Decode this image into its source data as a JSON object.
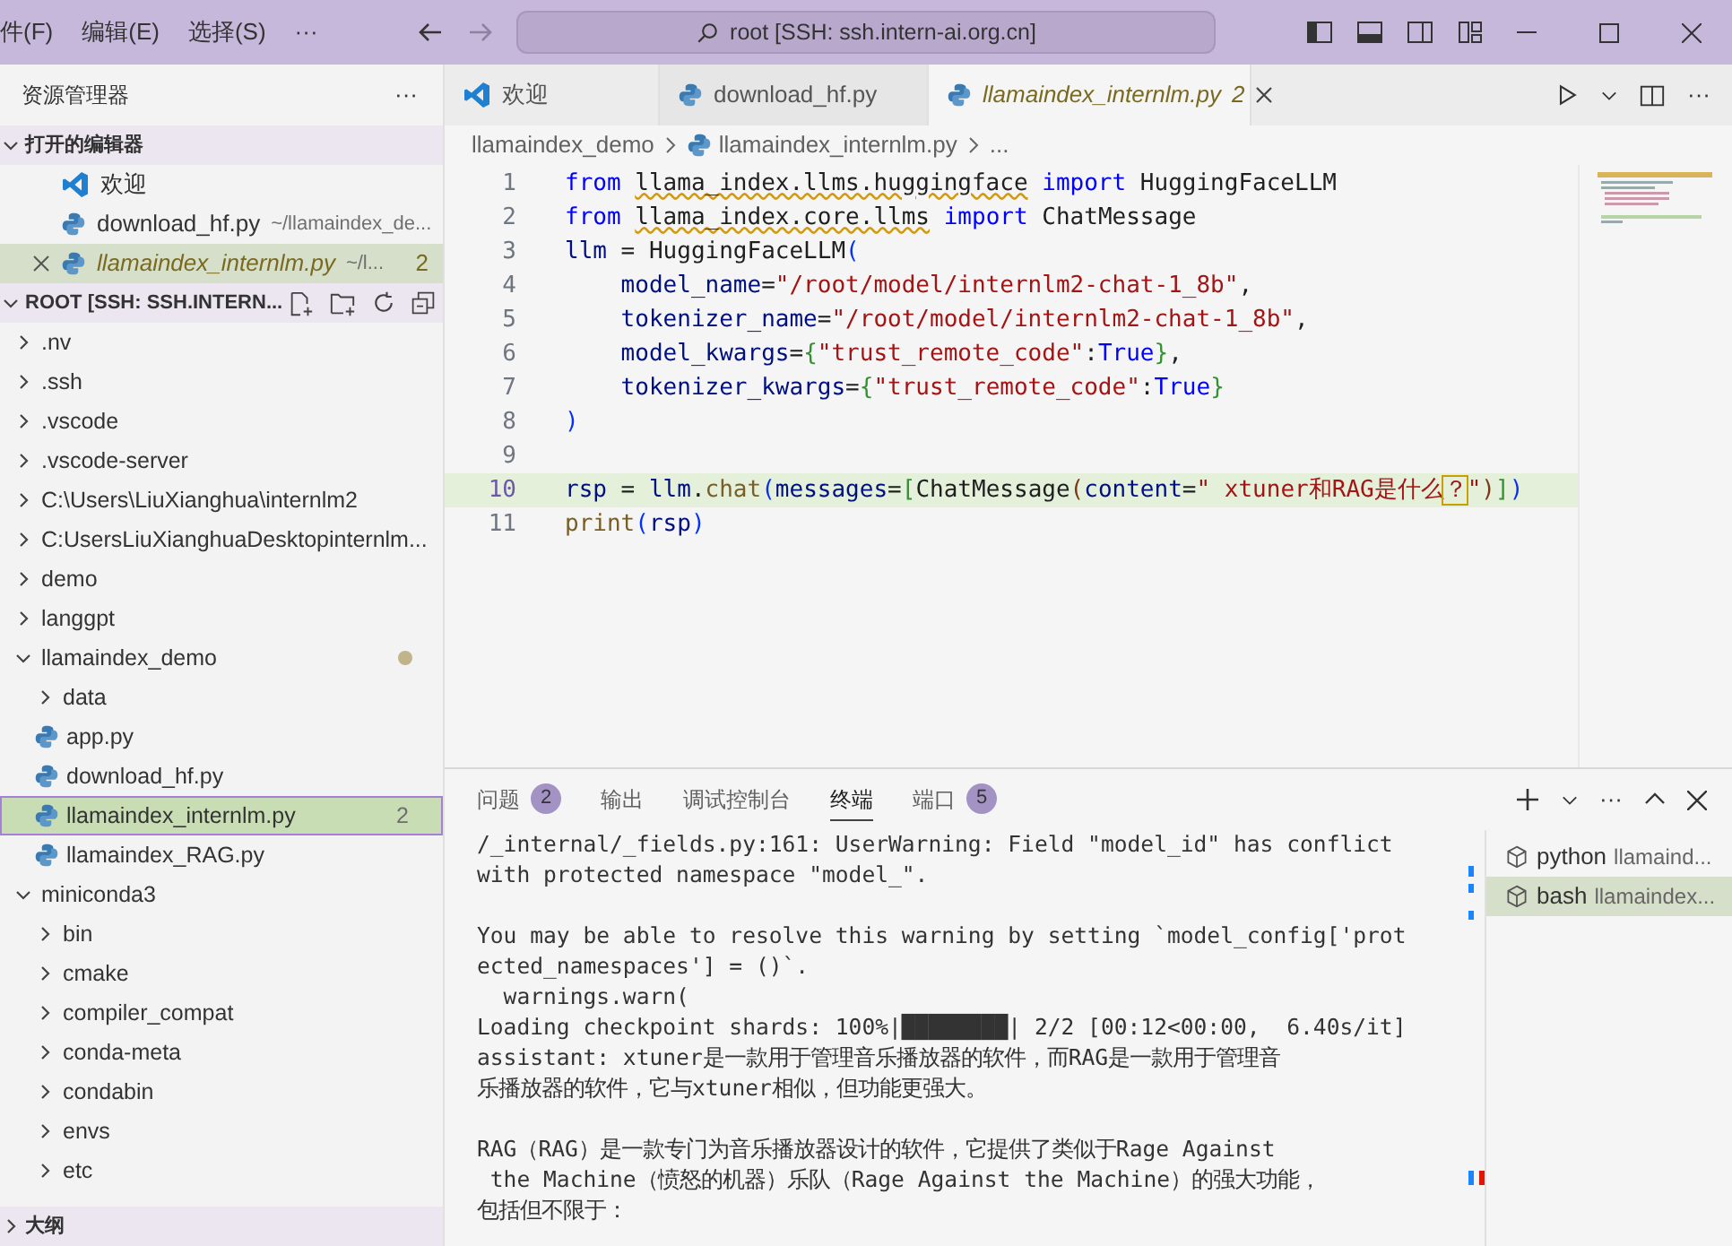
{
  "menu": [
    "件(F)",
    "编辑(E)",
    "选择(S)",
    "···"
  ],
  "command_center": "root [SSH: ssh.intern-ai.org.cn]",
  "sidebar": {
    "title": "资源管理器",
    "more": "···",
    "open_editors": {
      "title": "打开的编辑器",
      "expanded": true,
      "items": [
        {
          "kind": "welcome",
          "label": "欢迎",
          "selected": false,
          "preview": false
        },
        {
          "kind": "python",
          "label": "download_hf.py",
          "path": "~/llamaindex_de...",
          "selected": false,
          "preview": false
        },
        {
          "kind": "python",
          "label": "llamaindex_internlm.py",
          "path": "~/l...",
          "badge": "2",
          "selected": true,
          "preview": true
        }
      ]
    },
    "root": {
      "title": "ROOT [SSH: SSH.INTERN...",
      "expanded": true,
      "items": [
        {
          "kind": "folder",
          "label": ".nv",
          "expanded": false,
          "selected": false
        },
        {
          "kind": "folder",
          "label": ".ssh",
          "expanded": false,
          "selected": false
        },
        {
          "kind": "folder",
          "label": ".vscode",
          "expanded": false,
          "selected": false
        },
        {
          "kind": "folder",
          "label": ".vscode-server",
          "expanded": false,
          "selected": false
        },
        {
          "kind": "folder",
          "label": "C:\\Users\\LiuXianghua\\internlm2",
          "expanded": false,
          "selected": false
        },
        {
          "kind": "folder",
          "label": "C:UsersLiuXianghuaDesktopinternlm...",
          "expanded": false,
          "selected": false
        },
        {
          "kind": "folder",
          "label": "demo",
          "expanded": false,
          "selected": false
        },
        {
          "kind": "folder",
          "label": "langgpt",
          "expanded": false,
          "selected": false
        },
        {
          "kind": "folder",
          "label": "llamaindex_demo",
          "expanded": true,
          "selected": false,
          "modified": true,
          "children": [
            {
              "kind": "folder",
              "label": "data",
              "expanded": false,
              "selected": false
            },
            {
              "kind": "python",
              "label": "app.py",
              "selected": false
            },
            {
              "kind": "python",
              "label": "download_hf.py",
              "selected": false
            },
            {
              "kind": "python",
              "label": "llamaindex_internlm.py",
              "selected": true,
              "badge": "2"
            },
            {
              "kind": "python",
              "label": "llamaindex_RAG.py",
              "selected": false
            }
          ]
        },
        {
          "kind": "folder",
          "label": "miniconda3",
          "expanded": true,
          "selected": false,
          "children": [
            {
              "kind": "folder",
              "label": "bin",
              "expanded": false,
              "selected": false
            },
            {
              "kind": "folder",
              "label": "cmake",
              "expanded": false,
              "selected": false
            },
            {
              "kind": "folder",
              "label": "compiler_compat",
              "expanded": false,
              "selected": false
            },
            {
              "kind": "folder",
              "label": "conda-meta",
              "expanded": false,
              "selected": false
            },
            {
              "kind": "folder",
              "label": "condabin",
              "expanded": false,
              "selected": false
            },
            {
              "kind": "folder",
              "label": "envs",
              "expanded": false,
              "selected": false
            },
            {
              "kind": "folder",
              "label": "etc",
              "expanded": false,
              "selected": false
            }
          ]
        }
      ]
    },
    "sections": [
      {
        "title": "大纲",
        "expanded": false
      }
    ]
  },
  "editor": {
    "tabs": [
      {
        "kind": "welcome",
        "label": "欢迎",
        "selected": false,
        "preview": false
      },
      {
        "kind": "python",
        "label": "download_hf.py",
        "selected": false,
        "preview": false
      },
      {
        "kind": "python",
        "label": "llamaindex_internlm.py",
        "badge": "2",
        "selected": true,
        "preview": true
      }
    ],
    "breadcrumbs": [
      "llamaindex_demo",
      "llamaindex_internlm.py",
      "..."
    ],
    "lines": [
      {
        "number": "1",
        "current": false,
        "tokens": [
          {
            "text": "from ",
            "kind": "keyword"
          },
          {
            "text": "llama_index.llms.huggingface",
            "kind": "warning"
          },
          {
            "text": " import",
            "kind": "keyword"
          },
          {
            "text": " HuggingFaceLLM",
            "kind": "plain"
          }
        ]
      },
      {
        "number": "2",
        "current": false,
        "tokens": [
          {
            "text": "from ",
            "kind": "keyword"
          },
          {
            "text": "llama_index.core.llms",
            "kind": "warning"
          },
          {
            "text": " import",
            "kind": "keyword"
          },
          {
            "text": " ChatMessage",
            "kind": "plain"
          }
        ]
      },
      {
        "number": "3",
        "current": false,
        "tokens": [
          {
            "text": "llm",
            "kind": "variable"
          },
          {
            "text": " = HuggingFaceLLM",
            "kind": "plain"
          },
          {
            "text": "(",
            "kind": "bracket1"
          }
        ]
      },
      {
        "number": "4",
        "current": false,
        "tokens": [
          {
            "text": "    model_name",
            "kind": "variable"
          },
          {
            "text": "=",
            "kind": "plain"
          },
          {
            "text": "\"/root/model/internlm2-chat-1_8b\"",
            "kind": "string"
          },
          {
            "text": ",",
            "kind": "plain"
          }
        ]
      },
      {
        "number": "5",
        "current": false,
        "tokens": [
          {
            "text": "    tokenizer_name",
            "kind": "variable"
          },
          {
            "text": "=",
            "kind": "plain"
          },
          {
            "text": "\"/root/model/internlm2-chat-1_8b\"",
            "kind": "string"
          },
          {
            "text": ",",
            "kind": "plain"
          }
        ]
      },
      {
        "number": "6",
        "current": false,
        "tokens": [
          {
            "text": "    model_kwargs",
            "kind": "variable"
          },
          {
            "text": "=",
            "kind": "plain"
          },
          {
            "text": "{",
            "kind": "bracket2"
          },
          {
            "text": "\"trust_remote_code\"",
            "kind": "string"
          },
          {
            "text": ":",
            "kind": "plain"
          },
          {
            "text": "True",
            "kind": "constant"
          },
          {
            "text": "}",
            "kind": "bracket2"
          },
          {
            "text": ",",
            "kind": "plain"
          }
        ]
      },
      {
        "number": "7",
        "current": false,
        "tokens": [
          {
            "text": "    tokenizer_kwargs",
            "kind": "variable"
          },
          {
            "text": "=",
            "kind": "plain"
          },
          {
            "text": "{",
            "kind": "bracket2"
          },
          {
            "text": "\"trust_remote_code\"",
            "kind": "string"
          },
          {
            "text": ":",
            "kind": "plain"
          },
          {
            "text": "True",
            "kind": "constant"
          },
          {
            "text": "}",
            "kind": "bracket2"
          }
        ]
      },
      {
        "number": "8",
        "current": false,
        "tokens": [
          {
            "text": ")",
            "kind": "bracket1"
          }
        ]
      },
      {
        "number": "9",
        "current": false
      },
      {
        "number": "10",
        "current": true,
        "tokens": [
          {
            "text": "rsp",
            "kind": "variable"
          },
          {
            "text": " = ",
            "kind": "plain"
          },
          {
            "text": "llm",
            "kind": "variable"
          },
          {
            "text": ".",
            "kind": "plain"
          },
          {
            "text": "chat",
            "kind": "function"
          },
          {
            "text": "(",
            "kind": "bracket1"
          },
          {
            "text": "messages",
            "kind": "variable"
          },
          {
            "text": "=",
            "kind": "plain"
          },
          {
            "text": "[",
            "kind": "bracket2"
          },
          {
            "text": "ChatMessage",
            "kind": "plain"
          },
          {
            "text": "(",
            "kind": "bracket3"
          },
          {
            "text": "content",
            "kind": "variable"
          },
          {
            "text": "=",
            "kind": "plain"
          },
          {
            "text": "\" xtuner和RAG是什么",
            "kind": "string"
          },
          {
            "text": "？",
            "kind": "boxed"
          },
          {
            "text": "\"",
            "kind": "string"
          },
          {
            "text": ")",
            "kind": "bracket3"
          },
          {
            "text": "]",
            "kind": "bracket2"
          },
          {
            "text": ")",
            "kind": "bracket1"
          }
        ]
      },
      {
        "number": "11",
        "current": false,
        "tokens": [
          {
            "text": "print",
            "kind": "function"
          },
          {
            "text": "(",
            "kind": "bracket1"
          },
          {
            "text": "rsp",
            "kind": "variable"
          },
          {
            "text": ")",
            "kind": "bracket1"
          }
        ]
      }
    ]
  },
  "panel": {
    "tabs": [
      {
        "label": "问题",
        "badge": "2",
        "selected": false
      },
      {
        "label": "输出",
        "selected": false
      },
      {
        "label": "调试控制台",
        "selected": false
      },
      {
        "label": "终端",
        "selected": true
      },
      {
        "label": "端口",
        "badge": "5",
        "selected": false
      }
    ],
    "terminal_paragraphs": [
      [
        "/_internal/_fields.py:161: UserWarning: Field \"model_id\" has conflict",
        "with protected namespace \"model_\"."
      ],
      [
        "You may be able to resolve this warning by setting `model_config['prot",
        "ected_namespaces'] = ()`.",
        "  warnings.warn(",
        "Loading checkpoint shards: 100%|████████| 2/2 [00:12<00:00,  6.40s/it]",
        "assistant: xtuner是一款用于管理音乐播放器的软件，而RAG是一款用于管理音",
        "乐播放器的软件，它与xtuner相似，但功能更强大。"
      ],
      [
        "RAG（RAG）是一款专门为音乐播放器设计的软件，它提供了类似于Rage Against",
        " the Machine（愤怒的机器）乐队（Rage Against the Machine）的强大功能，",
        "包括但不限于："
      ]
    ],
    "terminals": [
      {
        "name": "python",
        "detail": "llamaind...",
        "selected": false
      },
      {
        "name": "bash",
        "detail": "llamaindex...",
        "selected": true
      }
    ]
  }
}
